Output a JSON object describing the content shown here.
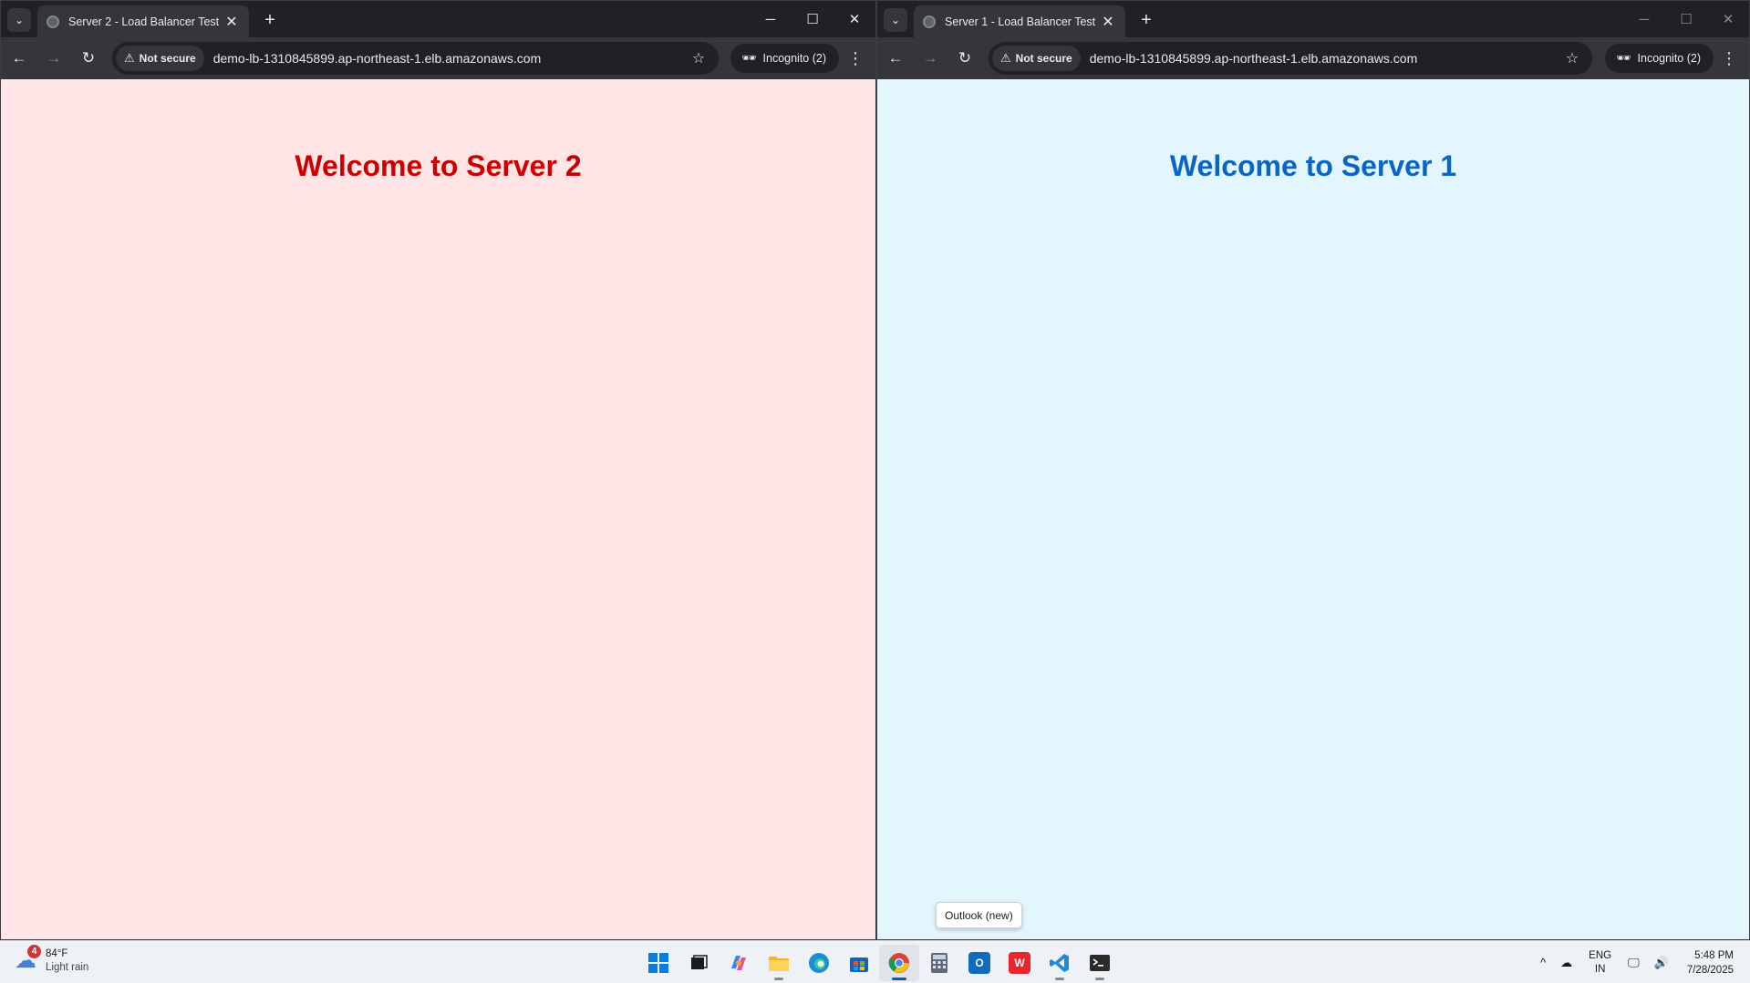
{
  "left_window": {
    "tab_title": "Server 2 - Load Balancer Test",
    "security_label": "Not secure",
    "url": "demo-lb-1310845899.ap-northeast-1.elb.amazonaws.com",
    "incognito_label": "Incognito (2)",
    "heading": "Welcome to Server 2",
    "background_color": "#ffe5e5",
    "heading_color": "#cc0000"
  },
  "right_window": {
    "tab_title": "Server 1 - Load Balancer Test",
    "security_label": "Not secure",
    "url": "demo-lb-1310845899.ap-northeast-1.elb.amazonaws.com",
    "incognito_label": "Incognito (2)",
    "heading": "Welcome to Server 1",
    "background_color": "#e3f5fd",
    "heading_color": "#0a66c2"
  },
  "tooltip": "Outlook (new)",
  "taskbar": {
    "weather_temp": "84°F",
    "weather_desc": "Light rain",
    "weather_badge": "4",
    "apps": [
      "start-icon",
      "task-view-icon",
      "copilot-icon",
      "file-explorer-icon",
      "edge-icon",
      "store-icon",
      "chrome-icon",
      "calculator-icon",
      "outlook-icon",
      "wps-office-icon",
      "vscode-icon",
      "terminal-icon"
    ],
    "lang_top": "ENG",
    "lang_bottom": "IN",
    "time": "5:48 PM",
    "date": "7/28/2025"
  }
}
